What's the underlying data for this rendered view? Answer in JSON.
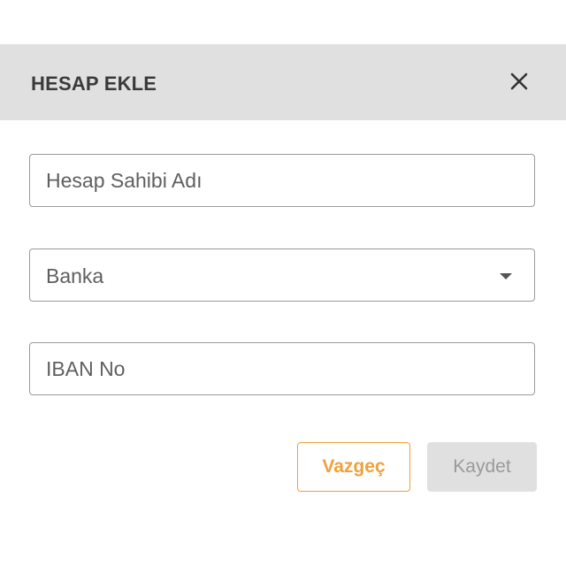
{
  "dialog": {
    "title": "HESAP EKLE",
    "close_icon": "close-icon"
  },
  "form": {
    "account_holder": {
      "placeholder": "Hesap Sahibi Adı",
      "value": ""
    },
    "bank": {
      "selected": "Banka",
      "icon": "caret-down-icon"
    },
    "iban": {
      "placeholder": "IBAN No",
      "value": ""
    }
  },
  "actions": {
    "cancel_label": "Vazgeç",
    "save_label": "Kaydet",
    "save_disabled": true
  },
  "colors": {
    "header_bg": "#e0e0e0",
    "accent": "#f0a13a",
    "disabled_bg": "#e0e0e0",
    "disabled_text": "#9a9a9a"
  }
}
